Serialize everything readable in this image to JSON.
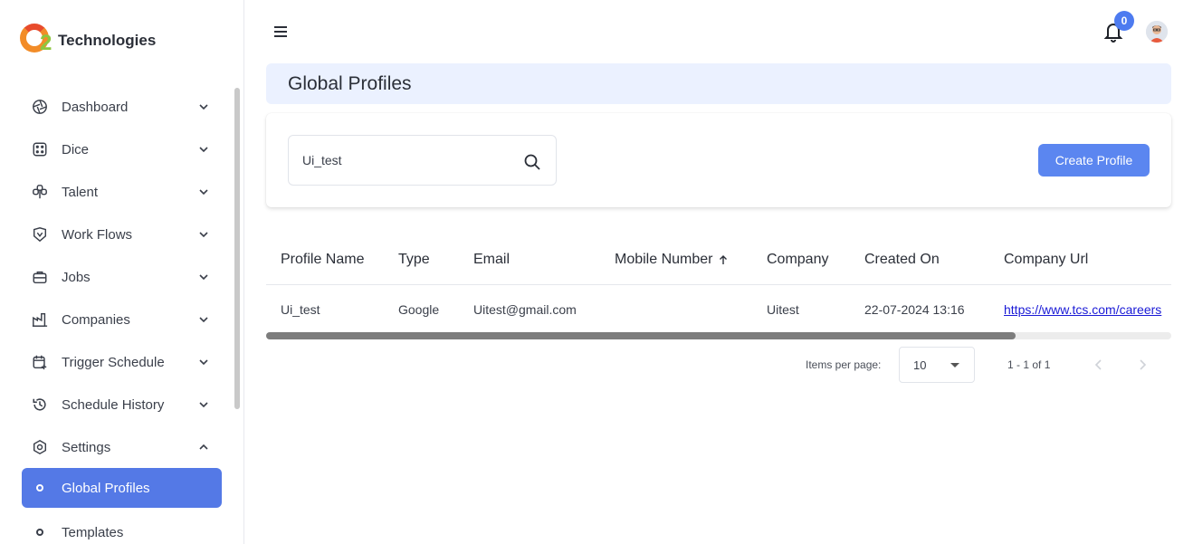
{
  "brand": {
    "name": "Technologies",
    "logo_mark": "2"
  },
  "topbar": {
    "notification_count": "0"
  },
  "page": {
    "title": "Global Profiles"
  },
  "sidebar": {
    "items": [
      {
        "label": "Dashboard",
        "icon": "dashboard-icon"
      },
      {
        "label": "Dice",
        "icon": "dice-icon"
      },
      {
        "label": "Talent",
        "icon": "talent-icon"
      },
      {
        "label": "Work Flows",
        "icon": "workflows-icon"
      },
      {
        "label": "Jobs",
        "icon": "briefcase-icon"
      },
      {
        "label": "Companies",
        "icon": "factory-icon"
      },
      {
        "label": "Trigger Schedule",
        "icon": "calendar-plus-icon"
      },
      {
        "label": "Schedule History",
        "icon": "history-icon"
      },
      {
        "label": "Settings",
        "icon": "settings-icon"
      }
    ],
    "sub_items": [
      {
        "label": "Global Profiles",
        "active": true
      },
      {
        "label": "Templates",
        "active": false
      }
    ]
  },
  "search": {
    "value": "Ui_test",
    "placeholder": ""
  },
  "actions": {
    "create_label": "Create Profile"
  },
  "table": {
    "columns": [
      "Profile Name",
      "Type",
      "Email",
      "Mobile Number",
      "Company",
      "Created On",
      "Company Url"
    ],
    "sorted_column": "Mobile Number",
    "rows": [
      {
        "profile_name": "Ui_test",
        "type": "Google",
        "email": "Uitest@gmail.com",
        "mobile": "",
        "company": "Uitest",
        "created_on": "22-07-2024 13:16",
        "company_url": "https://www.tcs.com/careers"
      }
    ]
  },
  "paginator": {
    "items_per_page_label": "Items per page:",
    "items_per_page": "10",
    "range": "1 - 1 of 1"
  },
  "colors": {
    "accent": "#5479e6",
    "button": "#5b86f0",
    "title_bg": "#ebf1ff",
    "badge": "#4d7bf0"
  }
}
